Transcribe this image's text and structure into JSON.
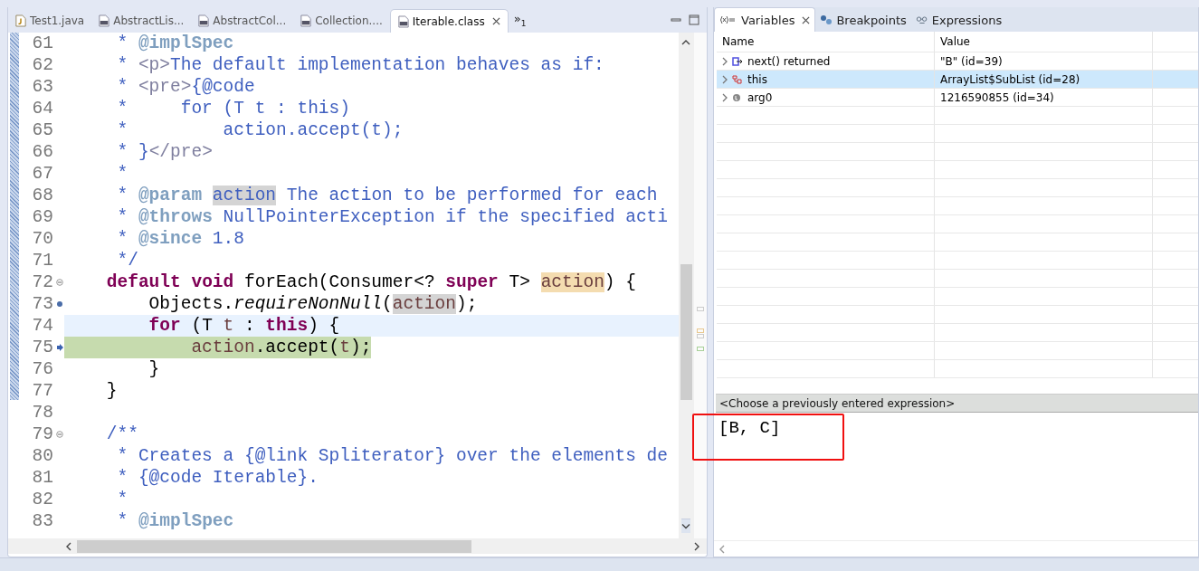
{
  "editor": {
    "tabs": [
      {
        "label": "Test1.java",
        "kind": "source",
        "selected": false,
        "closable": false
      },
      {
        "label": "AbstractLis...",
        "kind": "binary",
        "selected": false,
        "closable": false
      },
      {
        "label": "AbstractCol...",
        "kind": "binary",
        "selected": false,
        "closable": false
      },
      {
        "label": "Collection....",
        "kind": "binary",
        "selected": false,
        "closable": false
      },
      {
        "label": "Iterable.class",
        "kind": "binary",
        "selected": true,
        "closable": true
      }
    ],
    "more_tabs": "»",
    "more_tabs_count": "1",
    "lines": [
      {
        "number": "61",
        "kind": "text",
        "current": false,
        "executing": false,
        "tokens": [
          {
            "text": "     * ",
            "kind": "comment"
          },
          {
            "text": "@implSpec",
            "kind": "doctag"
          }
        ]
      },
      {
        "number": "62",
        "kind": "text",
        "current": false,
        "executing": false,
        "tokens": [
          {
            "text": "     * ",
            "kind": "comment"
          },
          {
            "text": "<p>",
            "kind": "html"
          },
          {
            "text": "The default implementation behaves as if:",
            "kind": "comment"
          }
        ]
      },
      {
        "number": "63",
        "kind": "text",
        "current": false,
        "executing": false,
        "tokens": [
          {
            "text": "     * ",
            "kind": "comment"
          },
          {
            "text": "<pre>",
            "kind": "html"
          },
          {
            "text": "{@code",
            "kind": "comment"
          }
        ]
      },
      {
        "number": "64",
        "kind": "text",
        "current": false,
        "executing": false,
        "tokens": [
          {
            "text": "     *     for (T t : this)",
            "kind": "comment"
          }
        ]
      },
      {
        "number": "65",
        "kind": "text",
        "current": false,
        "executing": false,
        "tokens": [
          {
            "text": "     *         action.accept(t);",
            "kind": "comment"
          }
        ]
      },
      {
        "number": "66",
        "kind": "text",
        "current": false,
        "executing": false,
        "tokens": [
          {
            "text": "     * }",
            "kind": "comment"
          },
          {
            "text": "</pre>",
            "kind": "html"
          }
        ]
      },
      {
        "number": "67",
        "kind": "text",
        "current": false,
        "executing": false,
        "tokens": [
          {
            "text": "     *",
            "kind": "comment"
          }
        ]
      },
      {
        "number": "68",
        "kind": "text",
        "current": false,
        "executing": false,
        "tokens": [
          {
            "text": "     * ",
            "kind": "comment"
          },
          {
            "text": "@param ",
            "kind": "doctag"
          },
          {
            "text": "action",
            "kind": "doc-occurrence"
          },
          {
            "text": " The action to be performed for each",
            "kind": "comment"
          }
        ]
      },
      {
        "number": "69",
        "kind": "text",
        "current": false,
        "executing": false,
        "tokens": [
          {
            "text": "     * ",
            "kind": "comment"
          },
          {
            "text": "@throws",
            "kind": "doctag"
          },
          {
            "text": " NullPointerException if the specified acti",
            "kind": "comment"
          }
        ]
      },
      {
        "number": "70",
        "kind": "text",
        "current": false,
        "executing": false,
        "tokens": [
          {
            "text": "     * ",
            "kind": "comment"
          },
          {
            "text": "@since",
            "kind": "doctag"
          },
          {
            "text": " 1.8",
            "kind": "comment"
          }
        ]
      },
      {
        "number": "71",
        "kind": "text",
        "current": false,
        "executing": false,
        "tokens": [
          {
            "text": "     */",
            "kind": "comment"
          }
        ]
      },
      {
        "number": "72",
        "kind": "fold",
        "current": false,
        "executing": false,
        "tokens": [
          {
            "text": "    default",
            "kind": "keyword"
          },
          {
            "text": " void",
            "kind": "keyword"
          },
          {
            "text": " forEach(Consumer<? ",
            "kind": "plain"
          },
          {
            "text": "super",
            "kind": "keyword"
          },
          {
            "text": " T> ",
            "kind": "plain"
          },
          {
            "text": "action",
            "kind": "declaration"
          },
          {
            "text": ") {",
            "kind": "plain"
          }
        ]
      },
      {
        "number": "73",
        "kind": "breakpoint",
        "current": false,
        "executing": false,
        "tokens": [
          {
            "text": "        Objects.",
            "kind": "plain"
          },
          {
            "text": "requireNonNull",
            "kind": "static-method"
          },
          {
            "text": "(",
            "kind": "plain"
          },
          {
            "text": "action",
            "kind": "occurrence"
          },
          {
            "text": ");",
            "kind": "plain"
          }
        ]
      },
      {
        "number": "74",
        "kind": "text",
        "current": true,
        "executing": false,
        "tokens": [
          {
            "text": "        for",
            "kind": "keyword"
          },
          {
            "text": " (T ",
            "kind": "plain"
          },
          {
            "text": "t",
            "kind": "variable"
          },
          {
            "text": " : ",
            "kind": "plain"
          },
          {
            "text": "this",
            "kind": "keyword"
          },
          {
            "text": ") {",
            "kind": "plain"
          }
        ]
      },
      {
        "number": "75",
        "kind": "pointer",
        "current": false,
        "executing": true,
        "tokens": [
          {
            "text": "            action",
            "kind": "variable"
          },
          {
            "text": ".accept(",
            "kind": "plain"
          },
          {
            "text": "t",
            "kind": "variable"
          },
          {
            "text": ");",
            "kind": "plain"
          }
        ]
      },
      {
        "number": "76",
        "kind": "text",
        "current": false,
        "executing": false,
        "tokens": [
          {
            "text": "        }",
            "kind": "plain"
          }
        ]
      },
      {
        "number": "77",
        "kind": "text",
        "current": false,
        "executing": false,
        "tokens": [
          {
            "text": "    }",
            "kind": "plain"
          }
        ]
      },
      {
        "number": "78",
        "kind": "text",
        "current": false,
        "executing": false
      },
      {
        "number": "79",
        "kind": "fold",
        "current": false,
        "executing": false,
        "tokens": [
          {
            "text": "    /**",
            "kind": "comment"
          }
        ]
      },
      {
        "number": "80",
        "kind": "text",
        "current": false,
        "executing": false,
        "tokens": [
          {
            "text": "     * Creates a {@link Spliterator} over the elements de",
            "kind": "comment"
          }
        ]
      },
      {
        "number": "81",
        "kind": "text",
        "current": false,
        "executing": false,
        "tokens": [
          {
            "text": "     * {@code Iterable}.",
            "kind": "comment"
          }
        ]
      },
      {
        "number": "82",
        "kind": "text",
        "current": false,
        "executing": false,
        "tokens": [
          {
            "text": "     *",
            "kind": "comment"
          }
        ]
      },
      {
        "number": "83",
        "kind": "text",
        "current": false,
        "executing": false,
        "tokens": [
          {
            "text": "     * ",
            "kind": "comment"
          },
          {
            "text": "@implSpec",
            "kind": "doctag"
          }
        ]
      }
    ]
  },
  "debug": {
    "tabs": [
      {
        "label": "Variables",
        "kind": "variables",
        "selected": true,
        "closable": true
      },
      {
        "label": "Breakpoints",
        "kind": "breakpoints",
        "selected": false,
        "closable": false
      },
      {
        "label": "Expressions",
        "kind": "expressions",
        "selected": false,
        "closable": false
      }
    ],
    "columns": [
      "Name",
      "Value"
    ],
    "rows": [
      {
        "name": "next() returned",
        "value": "\"B\" (id=39)",
        "kind": "return",
        "selected": false
      },
      {
        "name": "this",
        "value": "ArrayList$SubList  (id=28)",
        "kind": "object",
        "selected": true
      },
      {
        "name": "arg0",
        "value": "1216590855  (id=34)",
        "kind": "local",
        "selected": false
      }
    ],
    "expression_combo": {
      "placeholder": "<Choose a previously entered expression>"
    },
    "details": "[B, C]"
  }
}
